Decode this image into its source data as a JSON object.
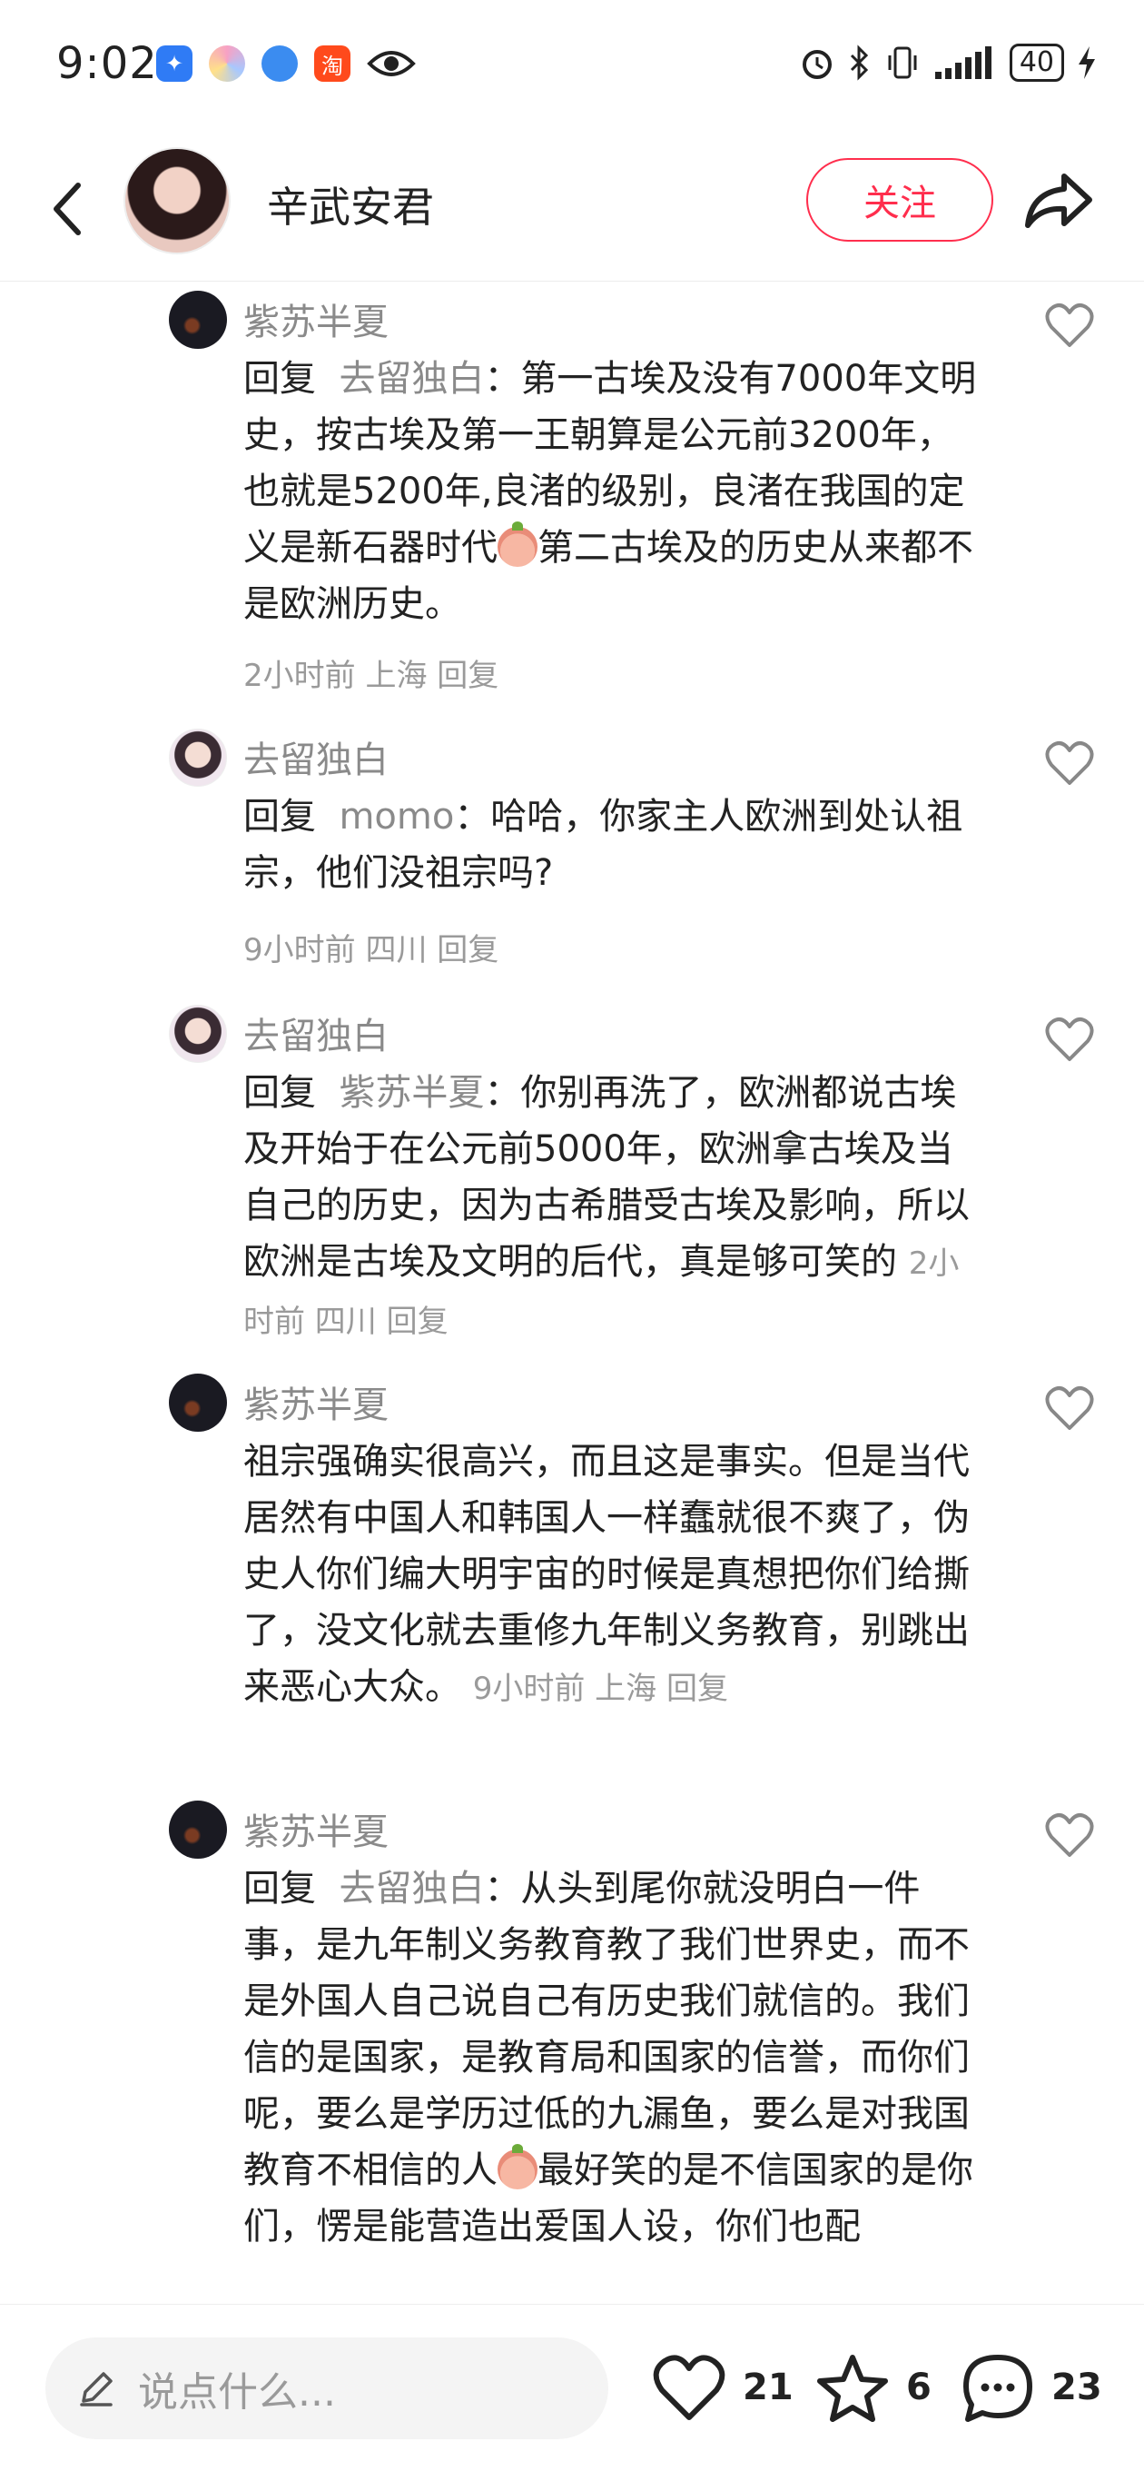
{
  "status_bar": {
    "time": "9:02",
    "apps": [
      "compass-app-icon",
      "color-ring-app-icon",
      "blue-app-icon",
      "taobao-app-icon",
      "eye-icon"
    ],
    "taobao_glyph": "淘",
    "battery": "40",
    "signal": "..ıl"
  },
  "header": {
    "name": "辛武安君",
    "follow_label": "关注"
  },
  "comments": [
    {
      "user": "紫苏半夏",
      "reply_prefix": "回复",
      "mention": "去留独白",
      "text_a": "：第一古埃及没有7000年文明史，按古埃及第一王朝算是公元前3200年，也就是5200年,良渚的级别，良渚在我国的定义是新石器时代",
      "text_b": "第二古埃及的历史从来都不是欧洲历史。",
      "meta": "2小时前 上海  回复"
    },
    {
      "user": "去留独白",
      "reply_prefix": "回复",
      "mention": "momo",
      "text_a": "：哈哈，你家主人欧洲到处认祖宗，他们没祖宗吗?",
      "meta": "9小时前 四川  回复"
    },
    {
      "user": "去留独白",
      "reply_prefix": "回复",
      "mention": "紫苏半夏",
      "text_a": "：你别再洗了，欧洲都说古埃及开始于在公元前5000年，欧洲拿古埃及当自己的历史，因为古希腊受古埃及影响，所以欧洲是古埃及文明的后代，真是够可笑的 ",
      "meta": "2小时前 四川  回复"
    },
    {
      "user": "紫苏半夏",
      "text_a": "祖宗强确实很高兴，而且这是事实。但是当代居然有中国人和韩国人一样蠢就很不爽了，伪史人你们编大明宇宙的时候是真想把你们给撕了，没文化就去重修九年制义务教育，别跳出来恶心大众。 ",
      "meta": "9小时前 上海  回复"
    },
    {
      "user": "紫苏半夏",
      "reply_prefix": "回复",
      "mention": "去留独白",
      "text_a": "：从头到尾你就没明白一件事，是九年制义务教育教了我们世界史，而不是外国人自己说自己有历史我们就信的。我们信的是国家，是教育局和国家的信誉，而你们呢，要么是学历过低的九漏鱼，要么是对我国教育不相信的人",
      "text_b": "最好笑的是不信国家的是你们，愣是能营造出爱国人设，你们也配"
    }
  ],
  "bottom_bar": {
    "input_placeholder": "说点什么...",
    "likes": "21",
    "favorites": "6",
    "comments": "23"
  }
}
